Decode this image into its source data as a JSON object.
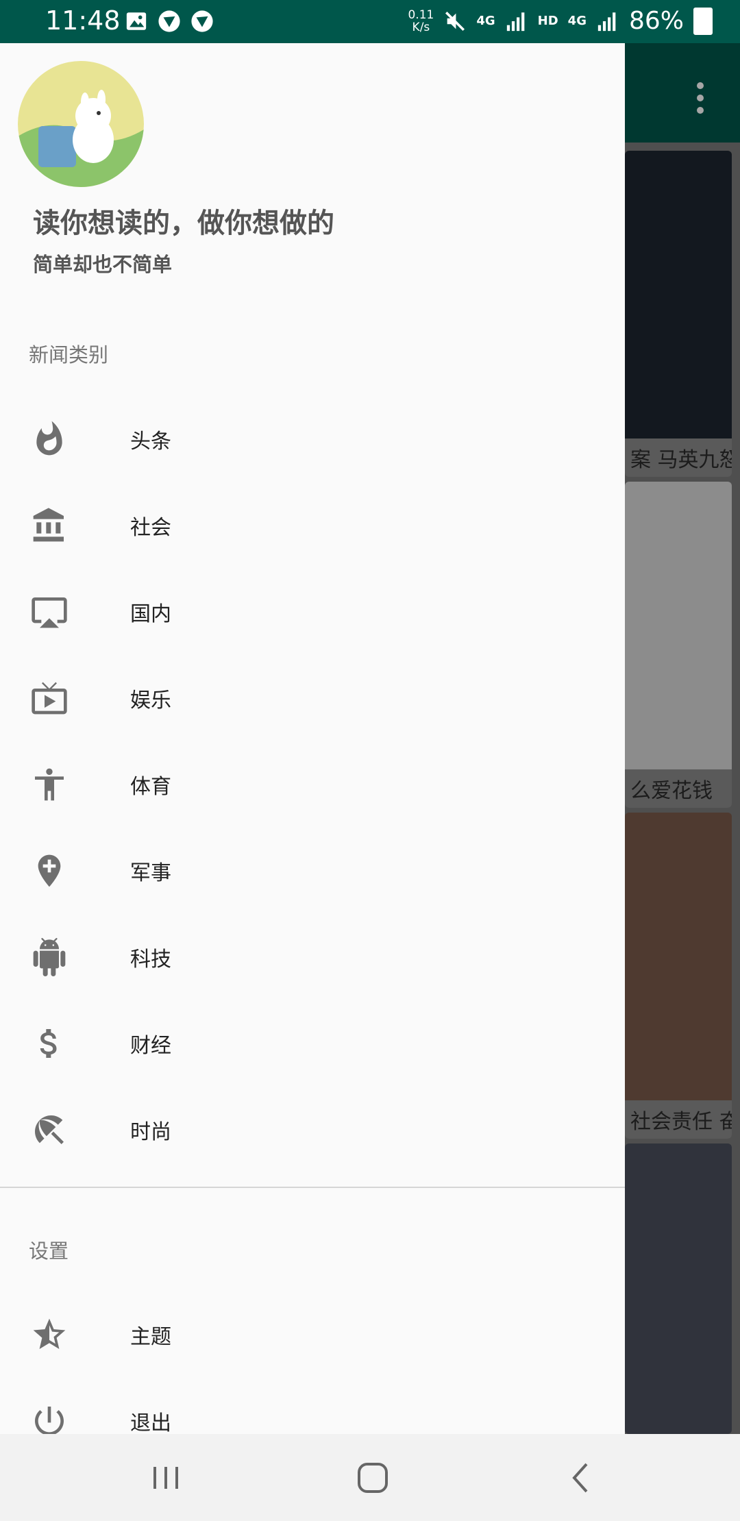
{
  "status_bar": {
    "time": "11:48",
    "net_speed_value": "0.11",
    "net_speed_unit": "K/s",
    "net_tag_1": "4G",
    "net_tag_2": "HD",
    "net_tag_3": "4G",
    "battery": "86%",
    "bg_color": "#00574b"
  },
  "background": {
    "cards": [
      {
        "caption": "案 马英九怒"
      },
      {
        "caption": "么爱花钱"
      },
      {
        "caption": "社会责任 奋"
      },
      {
        "caption": ""
      }
    ]
  },
  "drawer": {
    "header": {
      "tagline": "读你想读的，做你想做的",
      "subtagline": "简单却也不简单"
    },
    "sections": {
      "news": "新闻类别",
      "settings": "设置"
    },
    "news_items": [
      {
        "label": "头条",
        "icon": "fire-icon"
      },
      {
        "label": "社会",
        "icon": "bank-icon"
      },
      {
        "label": "国内",
        "icon": "airplay-icon"
      },
      {
        "label": "娱乐",
        "icon": "tv-icon"
      },
      {
        "label": "体育",
        "icon": "person-icon"
      },
      {
        "label": "军事",
        "icon": "location-plus-icon"
      },
      {
        "label": "科技",
        "icon": "android-icon"
      },
      {
        "label": "财经",
        "icon": "dollar-icon"
      },
      {
        "label": "时尚",
        "icon": "beach-umbrella-icon"
      }
    ],
    "settings_items": [
      {
        "label": "主题",
        "icon": "star-half-icon"
      },
      {
        "label": "退出",
        "icon": "power-icon"
      }
    ]
  },
  "colors": {
    "accent": "#00574b",
    "icon_gray": "#6f6f6f"
  }
}
